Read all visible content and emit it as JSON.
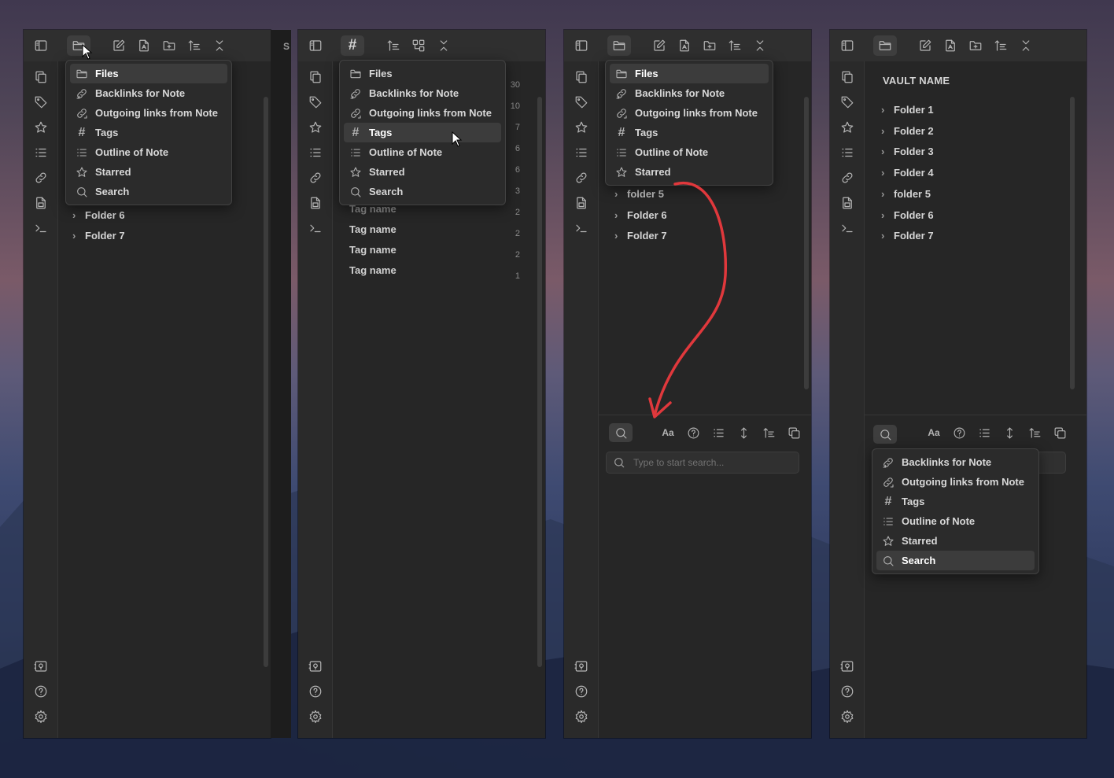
{
  "menu_options": {
    "files": "Files",
    "backlinks": "Backlinks for Note",
    "outgoing": "Outgoing links from Note",
    "tags": "Tags",
    "outline": "Outline of Note",
    "starred": "Starred",
    "search": "Search"
  },
  "panel1": {
    "truncated_tab": "S",
    "folders": [
      "Folder 6",
      "Folder 7"
    ]
  },
  "panel2": {
    "tag_rows": [
      "Tag name",
      "Tag name",
      "Tag name",
      "Tag name"
    ],
    "counts": [
      "30",
      "10",
      "7",
      "6",
      "6",
      "3",
      "2",
      "2",
      "2",
      "1"
    ]
  },
  "panel3": {
    "folders": [
      "folder 5",
      "Folder 6",
      "Folder 7"
    ],
    "search_placeholder": "Type to start search...",
    "match_case_label": "Aa"
  },
  "panel4": {
    "vault_name": "VAULT NAME",
    "folders": [
      "Folder 1",
      "Folder 2",
      "Folder 3",
      "Folder 4",
      "folder 5",
      "Folder 6",
      "Folder 7"
    ],
    "match_case_label": "Aa"
  },
  "colors": {
    "panel_bg": "#262626",
    "menu_bg": "#2b2b2b",
    "selected_bg": "#3c3c3c",
    "annotation_arrow": "#e0383c"
  },
  "icons": [
    "sidebar-toggle-icon",
    "folder-icon",
    "new-note-icon",
    "new-drawing-icon",
    "new-folder-icon",
    "sort-icon",
    "collapse-icon",
    "hash-icon",
    "auto-reveal-icon",
    "files-icon",
    "tag-icon",
    "star-icon",
    "list-icon",
    "link-icon",
    "template-icon",
    "terminal-icon",
    "vault-icon",
    "help-icon",
    "settings-icon",
    "search-icon",
    "backlink-icon",
    "outgoing-link-icon",
    "outline-icon"
  ]
}
